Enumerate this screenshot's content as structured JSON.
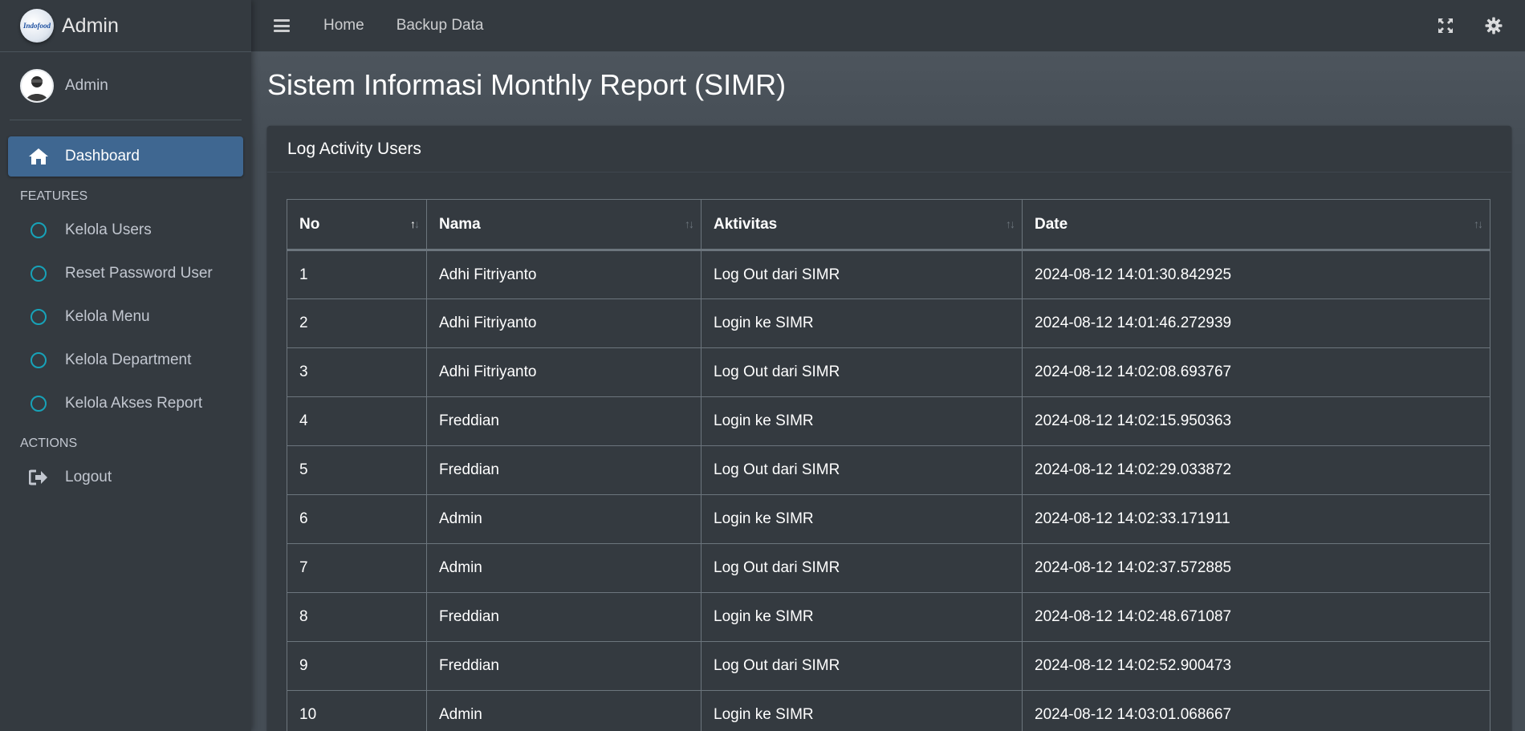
{
  "brand": {
    "logo_text": "Indofood",
    "name": "Admin"
  },
  "user": {
    "name": "Admin"
  },
  "sidebar": {
    "active": {
      "label": "Dashboard"
    },
    "features_header": "FEATURES",
    "features": [
      {
        "label": "Kelola Users"
      },
      {
        "label": "Reset Password User"
      },
      {
        "label": "Kelola Menu"
      },
      {
        "label": "Kelola Department"
      },
      {
        "label": "Kelola Akses Report"
      }
    ],
    "actions_header": "ACTIONS",
    "logout": {
      "label": "Logout"
    }
  },
  "topbar": {
    "home": "Home",
    "backup": "Backup Data"
  },
  "page": {
    "title": "Sistem Informasi Monthly Report (SIMR)"
  },
  "card": {
    "title": "Log Activity Users"
  },
  "table": {
    "headers": [
      "No",
      "Nama",
      "Aktivitas",
      "Date"
    ],
    "rows": [
      [
        "1",
        "Adhi Fitriyanto",
        "Log Out dari SIMR",
        "2024-08-12 14:01:30.842925"
      ],
      [
        "2",
        "Adhi Fitriyanto",
        "Login ke SIMR",
        "2024-08-12 14:01:46.272939"
      ],
      [
        "3",
        "Adhi Fitriyanto",
        "Log Out dari SIMR",
        "2024-08-12 14:02:08.693767"
      ],
      [
        "4",
        "Freddian",
        "Login ke SIMR",
        "2024-08-12 14:02:15.950363"
      ],
      [
        "5",
        "Freddian",
        "Log Out dari SIMR",
        "2024-08-12 14:02:29.033872"
      ],
      [
        "6",
        "Admin",
        "Login ke SIMR",
        "2024-08-12 14:02:33.171911"
      ],
      [
        "7",
        "Admin",
        "Log Out dari SIMR",
        "2024-08-12 14:02:37.572885"
      ],
      [
        "8",
        "Freddian",
        "Login ke SIMR",
        "2024-08-12 14:02:48.671087"
      ],
      [
        "9",
        "Freddian",
        "Log Out dari SIMR",
        "2024-08-12 14:02:52.900473"
      ],
      [
        "10",
        "Admin",
        "Login ke SIMR",
        "2024-08-12 14:03:01.068667"
      ]
    ]
  },
  "colors": {
    "sidebar_bg": "#343a40",
    "content_bg": "#454d55",
    "active_item": "#3f6791",
    "circle_accent": "#17a2b8"
  },
  "icons": {
    "menu": "hamburger-icon",
    "fullscreen": "expand-icon",
    "settings": "gear-icon",
    "dashboard": "home-icon",
    "feature": "circle-icon",
    "logout": "sign-out-icon"
  }
}
